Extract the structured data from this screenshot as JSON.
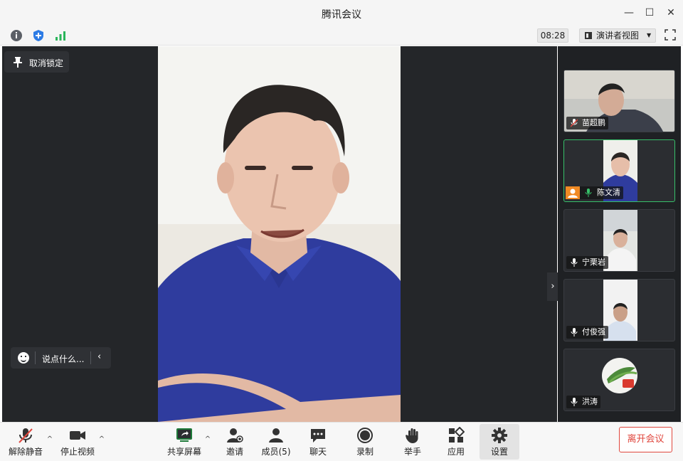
{
  "window": {
    "title": "腾讯会议",
    "minimize": "—",
    "maximize": "☐",
    "close": "✕"
  },
  "toolbar": {
    "clock": "08:28",
    "view_label": "演讲者视图",
    "view_caret": "▼"
  },
  "stage": {
    "unlock_label": "取消锁定",
    "chat_placeholder": "说点什么...",
    "chat_collapse": "‹",
    "panel_toggle": "›"
  },
  "participants": [
    {
      "name": "苗超鹏",
      "muted": true,
      "active": false
    },
    {
      "name": "陈文清",
      "muted": false,
      "active": true
    },
    {
      "name": "宁栗岩",
      "muted": false,
      "active": false
    },
    {
      "name": "付俊强",
      "muted": false,
      "active": false
    },
    {
      "name": "洪涛",
      "muted": false,
      "active": false
    }
  ],
  "bottom": {
    "unmute": "解除静音",
    "stop_video": "停止视频",
    "share": "共享屏幕",
    "invite": "邀请",
    "members": "成员(5)",
    "chat": "聊天",
    "record": "录制",
    "raise_hand": "举手",
    "apps": "应用",
    "settings": "设置",
    "leave": "离开会议",
    "caret": "^"
  },
  "colors": {
    "accent_green": "#37c06a",
    "leave_red": "#e0463d",
    "stage_bg": "#242629"
  }
}
